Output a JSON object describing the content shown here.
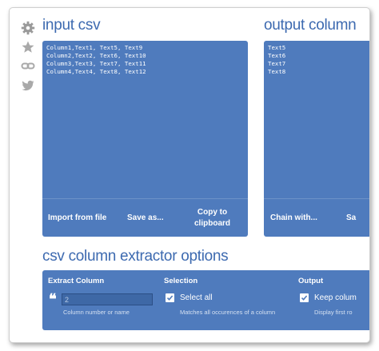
{
  "input_panel": {
    "heading": "input csv",
    "text": "Column1,Text1, Text5, Text9\nColumn2,Text2, Text6, Text10\nColumn3,Text3, Text7, Text11\nColumn4,Text4, Text8, Text12",
    "buttons": {
      "import": "Import from file",
      "save": "Save as...",
      "copy_line1": "Copy to",
      "copy_line2": "clipboard"
    }
  },
  "output_panel": {
    "heading": "output column",
    "text": "Text5\nText6\nText7\nText8",
    "buttons": {
      "chain": "Chain with...",
      "save_partial": "Sa"
    }
  },
  "options": {
    "heading": "csv column extractor options",
    "extract": {
      "title": "Extract Column",
      "quote_glyph": "❝",
      "input_value": "",
      "input_placeholder": "2",
      "hint": "Column number or name"
    },
    "selection": {
      "title": "Selection",
      "checkbox_label": "Select all",
      "checked": true,
      "hint": "Matches all occurences of a column"
    },
    "output": {
      "title": "Output",
      "checkbox_label": "Keep colum",
      "checked": true,
      "hint": "Display first ro"
    }
  },
  "colors": {
    "panel": "#4f7bbd",
    "heading": "#3d6ab0",
    "rail_icon": "#9a9a9a"
  },
  "icons": [
    "gear-icon",
    "star-icon",
    "link-icon",
    "twitter-icon"
  ]
}
